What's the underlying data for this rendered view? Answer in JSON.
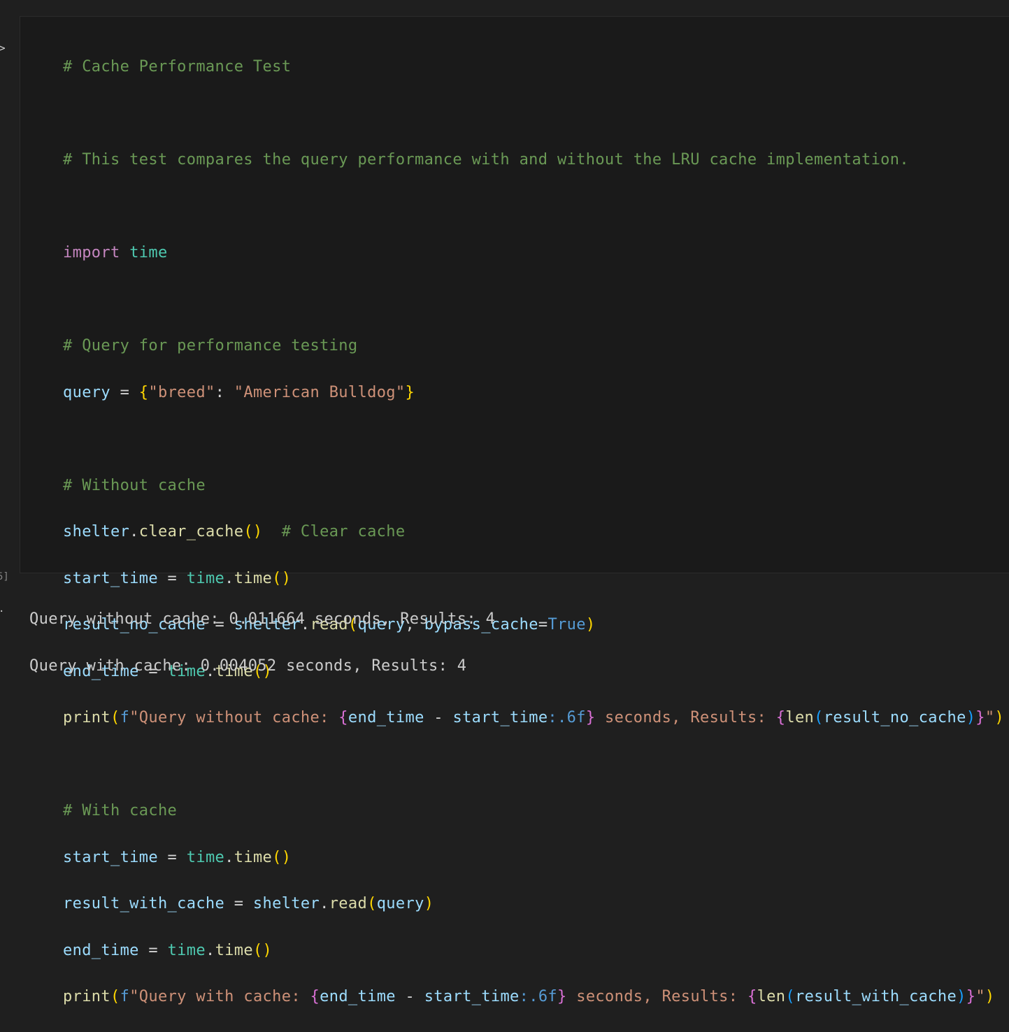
{
  "gutter": {
    "collapse_glyph": ">",
    "execution_count": "5]",
    "output_glyph": "·"
  },
  "code_cell": {
    "comment_title": "# Cache Performance Test",
    "comment_desc": "# This test compares the query performance with and without the LRU cache implementation.",
    "import_kw": "import",
    "import_mod": "time",
    "comment_query": "# Query for performance testing",
    "query_var": "query",
    "query_key": "\"breed\"",
    "query_value": "\"American Bulldog\"",
    "comment_without": "# Without cache",
    "shelter": "shelter",
    "clear_cache_fn": "clear_cache",
    "comment_clear": "# Clear cache",
    "start_time": "start_time",
    "end_time": "end_time",
    "time_mod": "time",
    "time_fn": "time",
    "result_no_cache": "result_no_cache",
    "read_fn": "read",
    "bypass_kw": "bypass_cache",
    "true_const": "True",
    "print_fn": "print",
    "fprefix": "f",
    "str_without": "\"Query without cache: ",
    "fmt_spec": ":.6f",
    "str_seconds": " seconds, Results: ",
    "len_fn": "len",
    "str_end": "\"",
    "comment_with": "# With cache",
    "result_with_cache": "result_with_cache",
    "str_with": "\"Query with cache: "
  },
  "output": {
    "line1": "Query without cache: 0.011664 seconds, Results: 4",
    "line2": "Query with cache: 0.004052 seconds, Results: 4"
  }
}
